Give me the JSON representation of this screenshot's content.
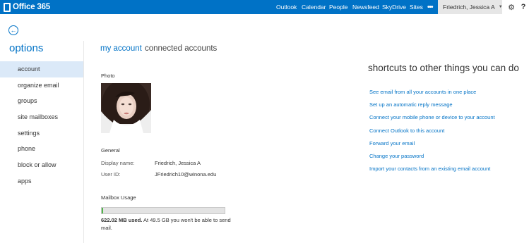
{
  "topbar": {
    "brand": "Office 365",
    "nav": [
      "Outlook",
      "Calendar",
      "People",
      "Newsfeed",
      "SkyDrive",
      "Sites"
    ],
    "more": "•••",
    "user_name": "Friedrich, Jessica A",
    "colors": {
      "bar": "#0072c6",
      "user_box": "#e6e6e6"
    }
  },
  "sidebar": {
    "title": "options",
    "items": [
      {
        "label": "account",
        "active": true
      },
      {
        "label": "organize email"
      },
      {
        "label": "groups"
      },
      {
        "label": "site mailboxes"
      },
      {
        "label": "settings"
      },
      {
        "label": "phone"
      },
      {
        "label": "block or allow"
      },
      {
        "label": "apps"
      }
    ]
  },
  "tabs": {
    "active": "my account",
    "other": "connected accounts"
  },
  "account": {
    "photo_label": "Photo",
    "general_label": "General",
    "display_name_label": "Display name:",
    "display_name": "Friedrich, Jessica A",
    "user_id_label": "User ID:",
    "user_id": "JFriedrich10@winona.edu",
    "mailbox_label": "Mailbox Usage",
    "usage_used": "622.02 MB used.",
    "usage_note": " At 49.5 GB you won't be able to send mail.",
    "usage_fraction": 0.012
  },
  "shortcuts": {
    "title": "shortcuts to other things you can do",
    "links": [
      "See email from all your accounts in one place",
      "Set up an automatic reply message",
      "Connect your mobile phone or device to your account",
      "Connect Outlook to this account",
      "Forward your email",
      "Change your password",
      "Import your contacts from an existing email account"
    ]
  }
}
